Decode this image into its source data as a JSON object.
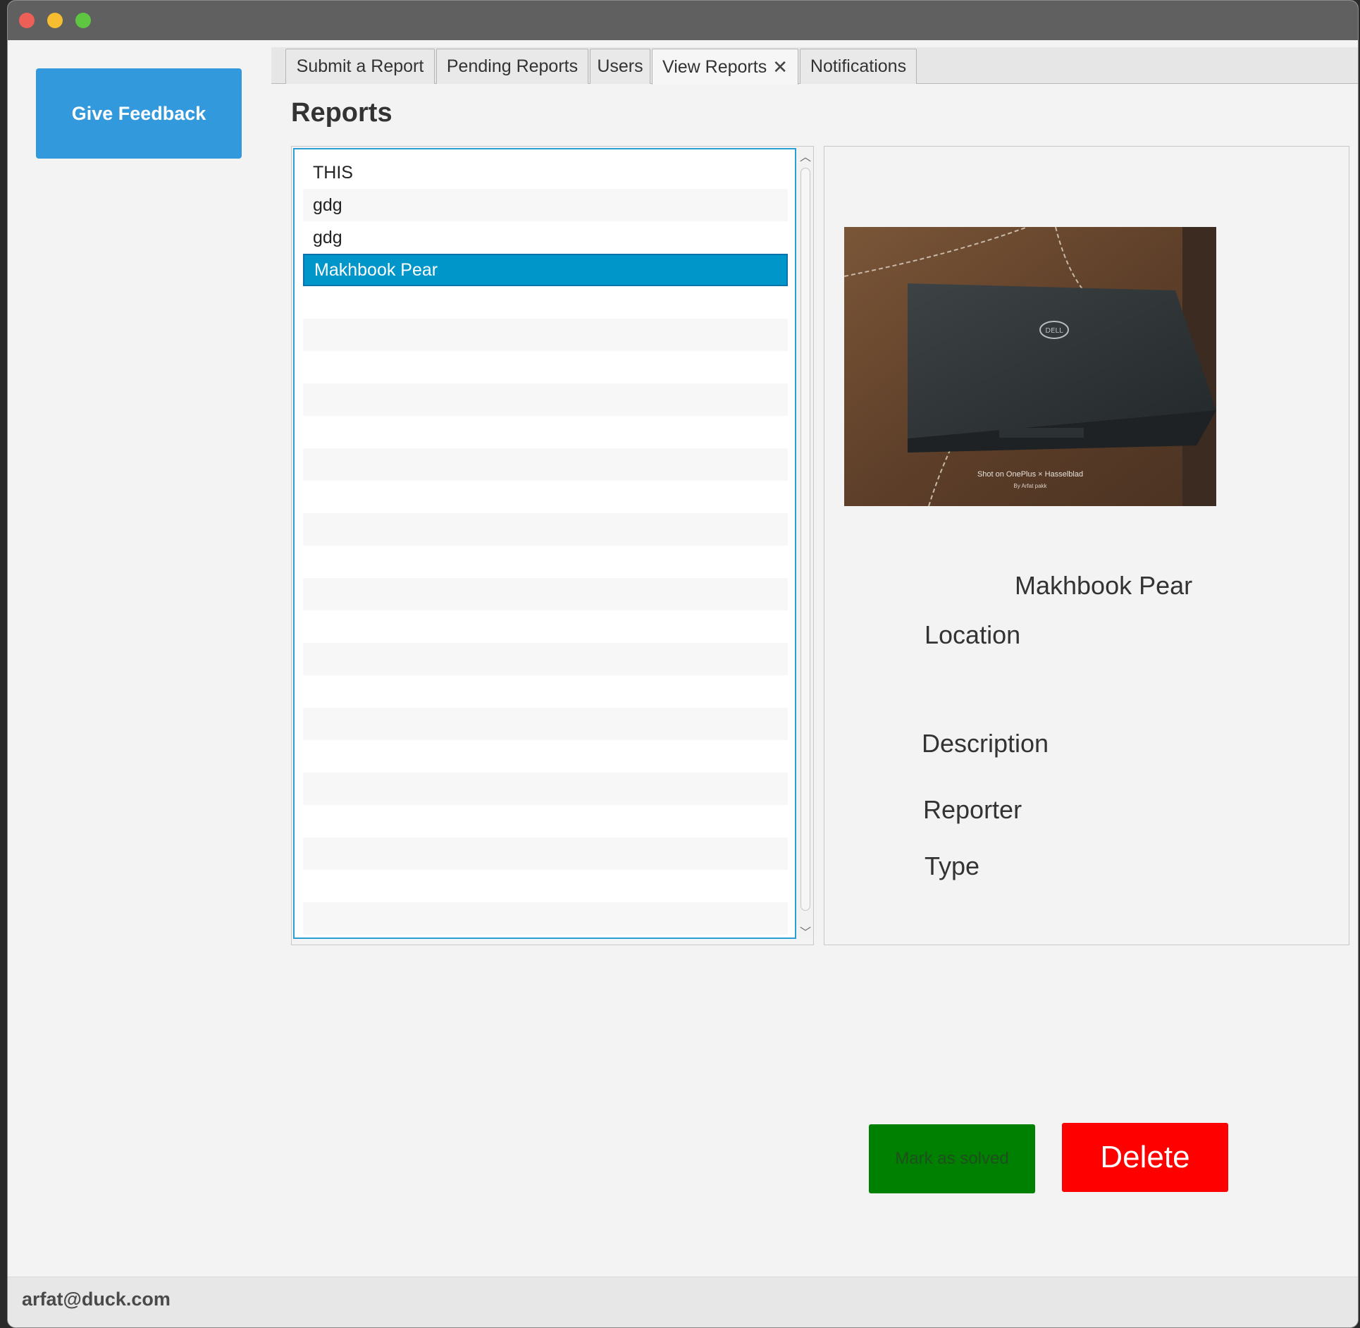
{
  "sidebar": {
    "feedback_label": "Give Feedback"
  },
  "tabs": [
    {
      "label": "Submit a Report"
    },
    {
      "label": "Pending Reports"
    },
    {
      "label": "Users"
    },
    {
      "label": "View Reports",
      "close": "✕"
    },
    {
      "label": "Notifications"
    }
  ],
  "main": {
    "title": "Reports"
  },
  "reports": [
    "THIS",
    "gdg",
    "gdg",
    "Makhbook Pear"
  ],
  "selected_report": "Makhbook Pear",
  "photo": {
    "watermark_line1": "Shot on OnePlus  ×  Hasselblad",
    "watermark_line2": "By Arfat pakk"
  },
  "detail": {
    "name": "Makhbook Pear",
    "location_label": "Location",
    "description_label": "Description",
    "reporter_label": "Reporter",
    "type_label": "Type"
  },
  "actions": {
    "solved_label": "Mark as solved",
    "delete_label": "Delete"
  },
  "status": {
    "email": "arfat@duck.com"
  },
  "colors": {
    "accent": "#3399dd",
    "selection": "#0096c9",
    "solved": "#008000",
    "delete": "#ff0000"
  }
}
